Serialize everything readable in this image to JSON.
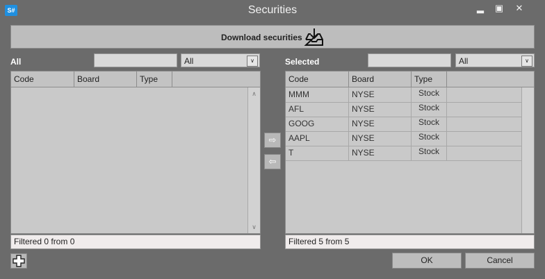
{
  "window": {
    "app_icon": "S#",
    "title": "Securities",
    "controls": [
      "minimize-icon",
      "maximize-icon",
      "close-icon"
    ]
  },
  "toolbar": {
    "download_label": "Download securities",
    "download_icon": "inbox-download-icon"
  },
  "all_panel": {
    "label": "All",
    "search_value": "",
    "filter_value": "All",
    "columns": [
      "Code",
      "Board",
      "Type"
    ],
    "rows": [],
    "status": "Filtered 0 from 0"
  },
  "selected_panel": {
    "label": "Selected",
    "search_value": "",
    "filter_value": "All",
    "columns": [
      "Code",
      "Board",
      "Type"
    ],
    "rows": [
      {
        "code": "MMM",
        "board": "NYSE",
        "type": "Stock"
      },
      {
        "code": "AFL",
        "board": "NYSE",
        "type": "Stock"
      },
      {
        "code": "GOOG",
        "board": "NYSE",
        "type": "Stock"
      },
      {
        "code": "AAPL",
        "board": "NYSE",
        "type": "Stock"
      },
      {
        "code": "T",
        "board": "NYSE",
        "type": "Stock"
      }
    ],
    "status": "Filtered 5 from 5"
  },
  "transfer": {
    "add_icon": "arrow-right-icon",
    "remove_icon": "arrow-left-icon"
  },
  "footer": {
    "add_icon": "plus-icon",
    "ok_label": "OK",
    "cancel_label": "Cancel"
  }
}
